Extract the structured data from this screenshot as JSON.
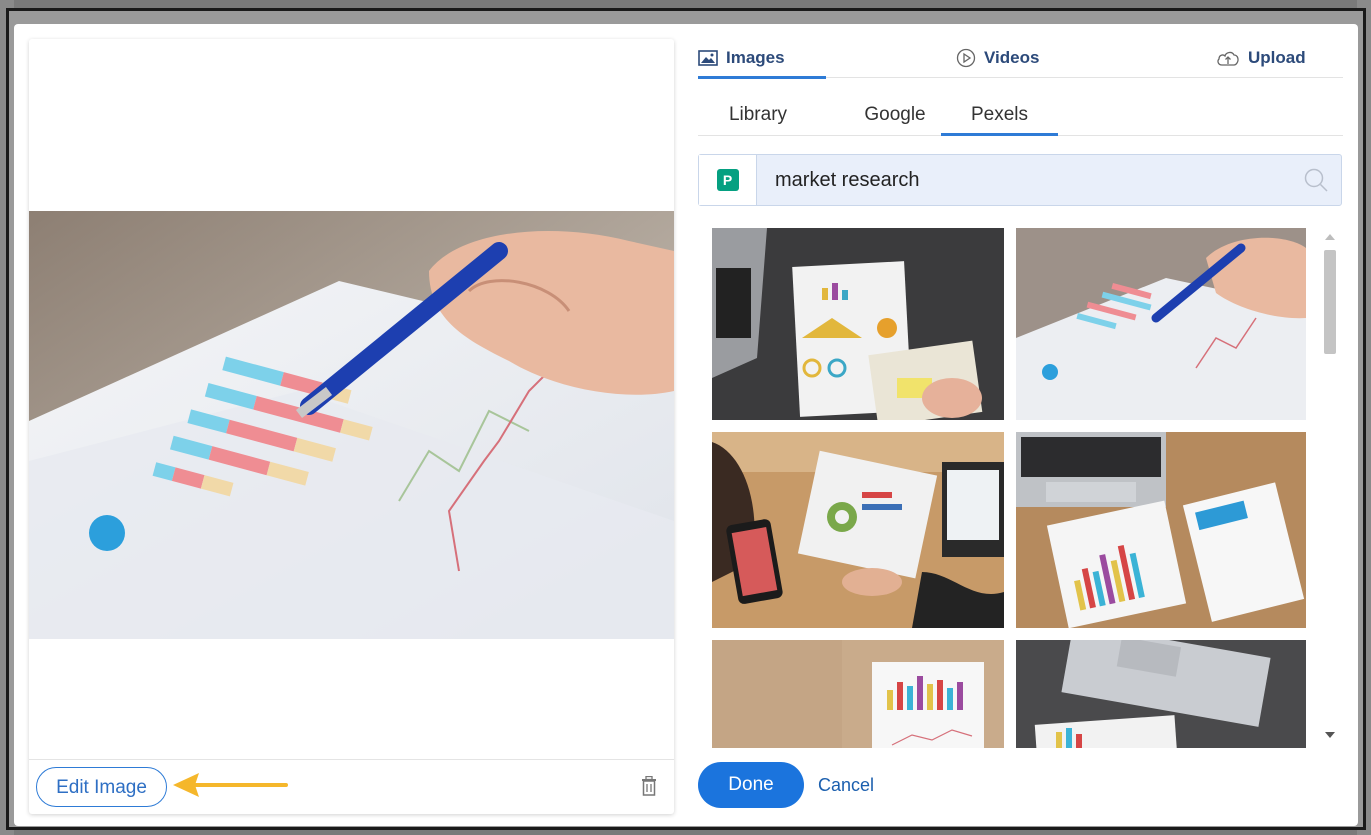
{
  "media_picker": {
    "tabs": [
      {
        "label": "Images",
        "icon": "image-icon",
        "active": true
      },
      {
        "label": "Videos",
        "icon": "play-circle-icon",
        "active": false
      },
      {
        "label": "Upload",
        "icon": "cloud-upload-icon",
        "active": false
      }
    ],
    "sources": [
      {
        "label": "Library",
        "active": false
      },
      {
        "label": "Google",
        "active": false
      },
      {
        "label": "Pexels",
        "active": true
      }
    ],
    "search": {
      "value": "market research",
      "provider_logo": "P"
    },
    "results": [
      {
        "name": "laptop-charts-notebook"
      },
      {
        "name": "pen-pointing-bar-chart"
      },
      {
        "name": "team-reviewing-infographic"
      },
      {
        "name": "laptop-bar-chart-reports"
      },
      {
        "name": "bar-chart-on-wood-desk"
      },
      {
        "name": "laptop-paper-charts"
      }
    ],
    "done_label": "Done",
    "cancel_label": "Cancel"
  },
  "preview_panel": {
    "edit_label": "Edit Image"
  },
  "colors": {
    "accent": "#1b74dd",
    "tab_text": "#2c4a7a",
    "search_bg": "#e9effa",
    "pexels_green": "#05a081",
    "arrow": "#f5b72b"
  }
}
